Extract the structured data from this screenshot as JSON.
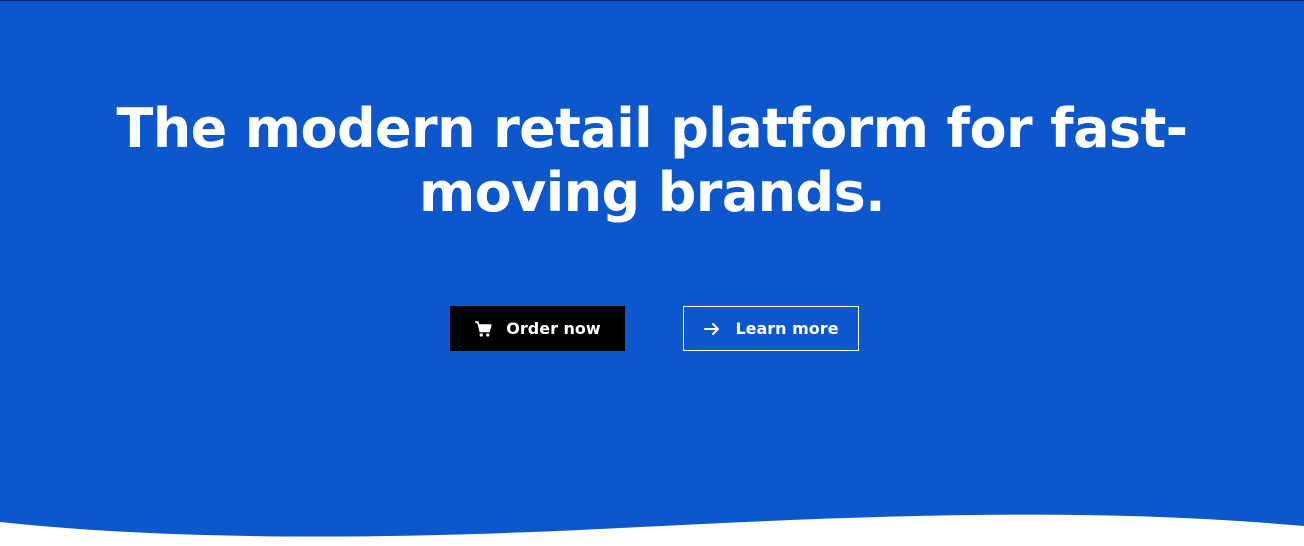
{
  "hero": {
    "headline_line1": "The modern retail platform for fast-",
    "headline_line2": "moving brands.",
    "background_color": "#0b57cb",
    "primary_button": {
      "label": "Order now",
      "icon": "shopping-cart-icon",
      "background_color": "#000000"
    },
    "secondary_button": {
      "label": "Learn more",
      "icon": "arrow-right-icon"
    }
  }
}
